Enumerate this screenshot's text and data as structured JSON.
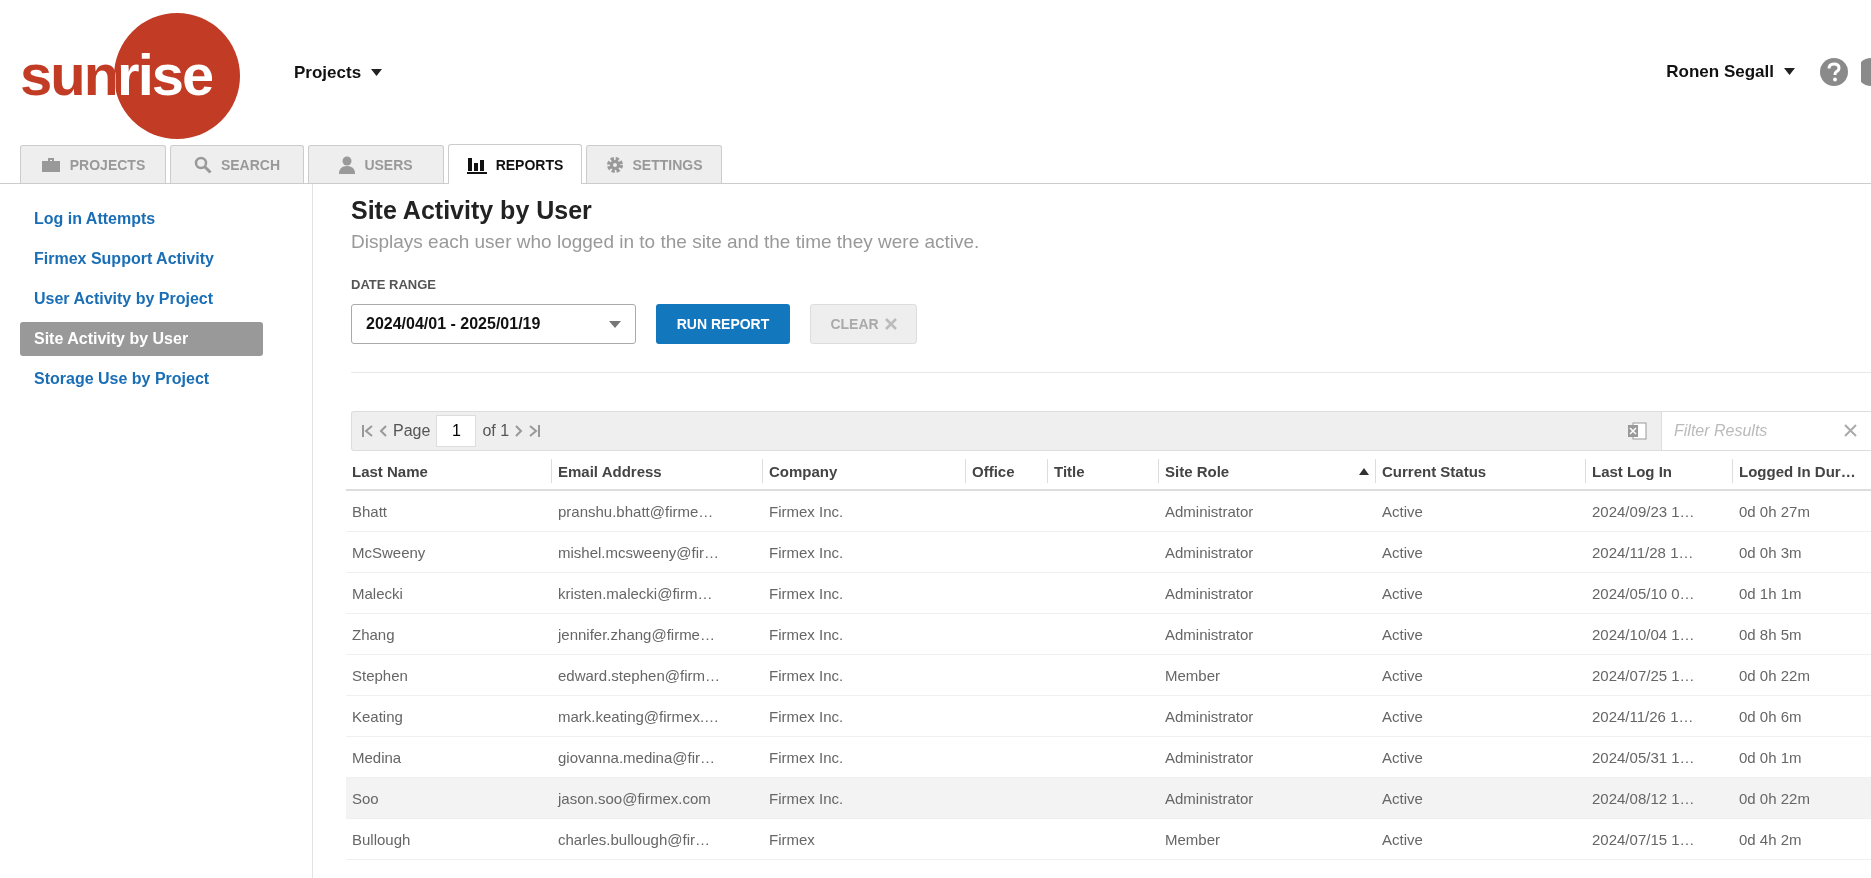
{
  "header": {
    "logo": "sunrise",
    "projects_menu": "Projects",
    "user_menu": "Ronen Segall"
  },
  "tabs": [
    {
      "label": "PROJECTS",
      "selected": false
    },
    {
      "label": "SEARCH",
      "selected": false
    },
    {
      "label": "USERS",
      "selected": false
    },
    {
      "label": "REPORTS",
      "selected": true
    },
    {
      "label": "SETTINGS",
      "selected": false
    }
  ],
  "sidebar": {
    "items": [
      {
        "label": "Log in Attempts",
        "selected": false
      },
      {
        "label": "Firmex Support Activity",
        "selected": false
      },
      {
        "label": "User Activity by Project",
        "selected": false
      },
      {
        "label": "Site Activity by User",
        "selected": true
      },
      {
        "label": "Storage Use by Project",
        "selected": false
      }
    ]
  },
  "report": {
    "title": "Site Activity by User",
    "description": "Displays each user who logged in to the site and the time they were active.",
    "date_range_label": "DATE RANGE",
    "date_range": "2024/04/01 - 2025/01/19",
    "buttons": [
      {
        "label": "RUN REPORT",
        "disabled": false
      },
      {
        "label": "CLEAR",
        "disabled": true
      }
    ]
  },
  "pager": {
    "page_label": "Page",
    "page": "1",
    "of": "of 1",
    "filter_placeholder": "Filter Results"
  },
  "table": {
    "columns": [
      {
        "label": "Last Name",
        "sorted": false
      },
      {
        "label": "Email Address",
        "sorted": false
      },
      {
        "label": "Company",
        "sorted": false
      },
      {
        "label": "Office",
        "sorted": false
      },
      {
        "label": "Title",
        "sorted": false
      },
      {
        "label": "Site Role",
        "sorted": true
      },
      {
        "label": "Current Status",
        "sorted": false
      },
      {
        "label": "Last Log In",
        "sorted": false
      },
      {
        "label": "Logged In Dur…",
        "sorted": false
      }
    ],
    "rows": [
      {
        "highlighted": false,
        "cells": [
          "Bhatt",
          "pranshu.bhatt@firme…",
          "Firmex Inc.",
          "",
          "",
          "Administrator",
          "Active",
          "2024/09/23 1…",
          "0d 0h 27m"
        ]
      },
      {
        "highlighted": false,
        "cells": [
          "McSweeny",
          "mishel.mcsweeny@fir…",
          "Firmex Inc.",
          "",
          "",
          "Administrator",
          "Active",
          "2024/11/28 1…",
          "0d 0h 3m"
        ]
      },
      {
        "highlighted": false,
        "cells": [
          "Malecki",
          "kristen.malecki@firm…",
          "Firmex Inc.",
          "",
          "",
          "Administrator",
          "Active",
          "2024/05/10 0…",
          "0d 1h 1m"
        ]
      },
      {
        "highlighted": false,
        "cells": [
          "Zhang",
          "jennifer.zhang@firme…",
          "Firmex Inc.",
          "",
          "",
          "Administrator",
          "Active",
          "2024/10/04 1…",
          "0d 8h 5m"
        ]
      },
      {
        "highlighted": false,
        "cells": [
          "Stephen",
          "edward.stephen@firm…",
          "Firmex Inc.",
          "",
          "",
          "Member",
          "Active",
          "2024/07/25 1…",
          "0d 0h 22m"
        ]
      },
      {
        "highlighted": false,
        "cells": [
          "Keating",
          "mark.keating@firmex.…",
          "Firmex Inc.",
          "",
          "",
          "Administrator",
          "Active",
          "2024/11/26 1…",
          "0d 0h 6m"
        ]
      },
      {
        "highlighted": false,
        "cells": [
          "Medina",
          "giovanna.medina@fir…",
          "Firmex Inc.",
          "",
          "",
          "Administrator",
          "Active",
          "2024/05/31 1…",
          "0d 0h 1m"
        ]
      },
      {
        "highlighted": true,
        "cells": [
          "Soo",
          "jason.soo@firmex.com",
          "Firmex Inc.",
          "",
          "",
          "Administrator",
          "Active",
          "2024/08/12 1…",
          "0d 0h 22m"
        ]
      },
      {
        "highlighted": false,
        "cells": [
          "Bullough",
          "charles.bullough@fir…",
          "Firmex",
          "",
          "",
          "Member",
          "Active",
          "2024/07/15 1…",
          "0d 4h 2m"
        ]
      }
    ]
  }
}
